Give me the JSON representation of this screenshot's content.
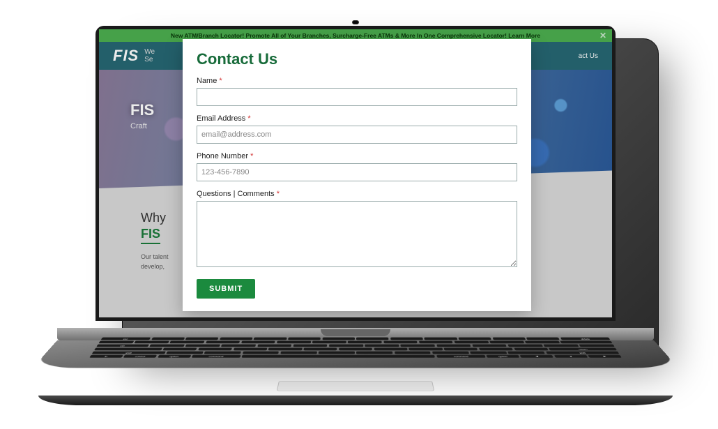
{
  "banner": {
    "text": "New ATM/Branch Locator! Promote All of Your Branches, Surcharge-Free ATMs & More In One Comprehensive Locator! Learn More"
  },
  "header": {
    "logo": "FIS",
    "logo_sub_line1": "We",
    "logo_sub_line2": "Se",
    "nav_contact": "act Us"
  },
  "hero": {
    "title_prefix": "FIS",
    "subtitle_prefix": "Craft"
  },
  "content": {
    "why_line1": "Why",
    "why_line2": "FIS",
    "body_line1": "Our talent",
    "body_line2": "develop,"
  },
  "modal": {
    "title": "Contact Us",
    "name_label": "Name",
    "email_label": "Email Address",
    "email_placeholder": "email@address.com",
    "phone_label": "Phone Number",
    "phone_placeholder": "123-456-7890",
    "comments_label": "Questions | Comments",
    "submit_label": "SUBMIT",
    "required_mark": "*"
  },
  "keyboard": {
    "row_bottom": [
      "fn",
      "control",
      "option",
      "command",
      "",
      "command",
      "option",
      "◀",
      "▼",
      "▶"
    ]
  }
}
